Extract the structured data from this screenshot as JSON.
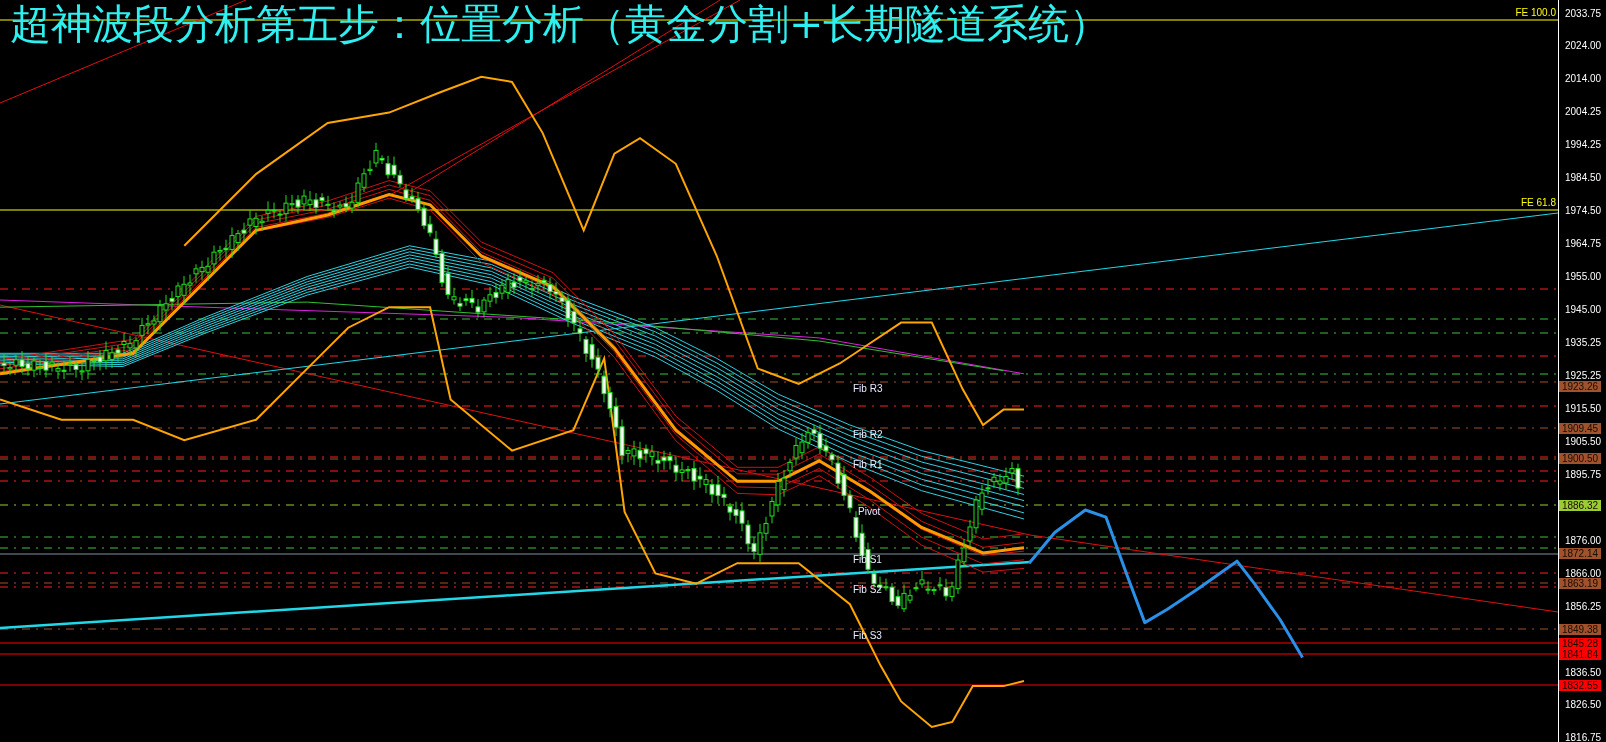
{
  "title": "超神波段分析第五步：位置分析（黄金分割+长期隧道系统）",
  "price_axis": {
    "ticks": [
      "2033.75",
      "2024.00",
      "2014.00",
      "2004.25",
      "1994.25",
      "1984.50",
      "1974.50",
      "1964.75",
      "1955.00",
      "1945.00",
      "1935.25",
      "1925.25",
      "1915.50",
      "1905.50",
      "1895.75",
      "1876.00",
      "1866.00",
      "1856.25",
      "1836.50",
      "1826.50",
      "1816.75"
    ]
  },
  "price_tags": [
    {
      "label": "1923.26",
      "color": "#a0522d"
    },
    {
      "label": "1909.45",
      "color": "#a0522d"
    },
    {
      "label": "1900.50",
      "color": "#a0522d"
    },
    {
      "label": "1886.32",
      "color": "#9acd32"
    },
    {
      "label": "1872.14",
      "color": "#a0522d"
    },
    {
      "label": "1863.19",
      "color": "#a0522d"
    },
    {
      "label": "1849.38",
      "color": "#a0522d"
    },
    {
      "label": "1845.28",
      "color": "#ff0000"
    },
    {
      "label": "1841.84",
      "color": "#ff0000"
    },
    {
      "label": "1832.55",
      "color": "#ff0000"
    }
  ],
  "expansion_labels": [
    "FE 100.0",
    "FE 61.8"
  ],
  "pivot_labels": [
    "Fib R3",
    "Fib R2",
    "Fib R1",
    "Pivot",
    "Fib S1",
    "Fib S2",
    "Fib S3"
  ]
}
